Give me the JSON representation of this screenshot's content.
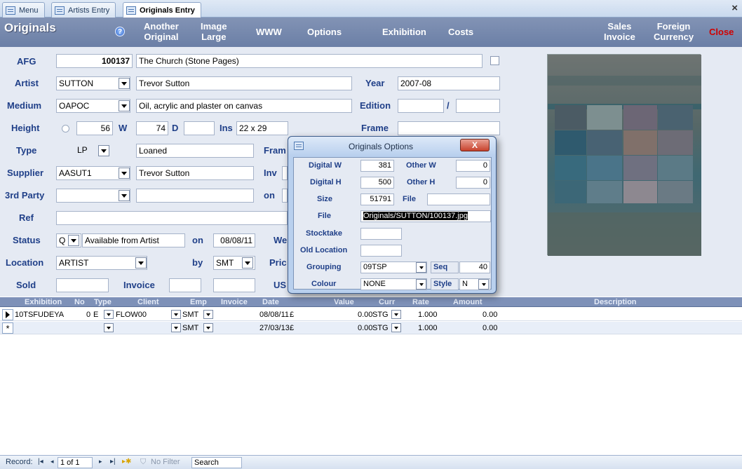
{
  "tabs": [
    {
      "label": "Menu"
    },
    {
      "label": "Artists Entry"
    },
    {
      "label": "Originals Entry"
    }
  ],
  "window_close": "×",
  "form_title": "Originals",
  "help_icon": "?",
  "header_buttons": {
    "another_original": "Another\nOriginal",
    "image_large": "Image\nLarge",
    "www": "WWW",
    "options": "Options",
    "exhibition": "Exhibition",
    "costs": "Costs",
    "sales_invoice": "Sales\nInvoice",
    "foreign_currency": "Foreign\nCurrency",
    "close": "Close"
  },
  "fields": {
    "afg_label": "AFG",
    "afg": "100137",
    "afg_title": "The Church (Stone Pages)",
    "artist_label": "Artist",
    "artist_code": "SUTTON",
    "artist_name": "Trevor Sutton",
    "year_label": "Year",
    "year": "2007-08",
    "medium_label": "Medium",
    "medium_code": "OAPOC",
    "medium_desc": "Oil, acrylic and plaster on canvas",
    "edition_label": "Edition",
    "edition_a": "",
    "edition_sep": "/",
    "edition_b": "",
    "height_label": "Height",
    "height": "56",
    "w_label": "W",
    "width": "74",
    "d_label": "D",
    "depth": "",
    "ins_label": "Ins",
    "ins": "22 x 29",
    "frame_label": "Frame",
    "frame": "",
    "type_label": "Type",
    "type_code": "LP",
    "type_desc": "Loaned",
    "frame2_label": "Fram",
    "supplier_label": "Supplier",
    "supplier_code": "AASUT1",
    "supplier_name": "Trevor Sutton",
    "inv_label": "Inv",
    "third_party_label": "3rd Party",
    "third_party_code": "",
    "third_party_name": "",
    "on_label": "on",
    "ref_label": "Ref",
    "ref": "",
    "status_label": "Status",
    "status_code": "Q",
    "status_desc": "Available from Artist",
    "status_on_label": "on",
    "status_date": "08/08/11",
    "we_label": "We",
    "location_label": "Location",
    "location": "ARTIST",
    "by_label": "by",
    "by": "SMT",
    "price_label": "Pric",
    "sold_label": "Sold",
    "sold": "",
    "invoice_label": "Invoice",
    "invoice_a": "",
    "invoice_b": "",
    "us_label": "US"
  },
  "datasheet": {
    "columns": [
      "Exhibition",
      "No",
      "Type",
      "Client",
      "Emp",
      "Invoice",
      "Date",
      "Value",
      "Curr",
      "Rate",
      "Amount",
      "Description"
    ],
    "rows": [
      {
        "exhibition": "10TSFUDEYA",
        "no": "0",
        "type": "E",
        "client": "FLOW00",
        "emp": "SMT",
        "invoice": "",
        "date": "08/08/11",
        "value": "£",
        "value_amt": "0.00",
        "curr": "STG",
        "rate": "1.000",
        "amount": "0.00",
        "description": ""
      },
      {
        "exhibition": "",
        "no": "",
        "type": "",
        "client": "",
        "emp": "SMT",
        "invoice": "",
        "date": "27/03/13",
        "value": "£",
        "value_amt": "0.00",
        "curr": "STG",
        "rate": "1.000",
        "amount": "0.00",
        "description": ""
      }
    ],
    "new_row_marker": "*"
  },
  "navbar": {
    "record_label": "Record:",
    "position": "1 of 1",
    "no_filter": "No Filter",
    "search": "Search"
  },
  "dialog": {
    "title": "Originals Options",
    "close": "X",
    "digital_w_label": "Digital W",
    "digital_w": "381",
    "other_w_label": "Other W",
    "other_w": "0",
    "digital_h_label": "Digital H",
    "digital_h": "500",
    "other_h_label": "Other H",
    "other_h": "0",
    "size_label": "Size",
    "size": "51791",
    "file_label_1": "File",
    "file_1": "",
    "file_label_2": "File",
    "file_2": "Originals/SUTTON/100137.jpg",
    "stocktake_label": "Stocktake",
    "stocktake": "",
    "old_location_label": "Old Location",
    "old_location": "",
    "grouping_label": "Grouping",
    "grouping": "09TSP",
    "seq_label": "Seq",
    "seq": "40",
    "colour_label": "Colour",
    "colour": "NONE",
    "style_label": "Style",
    "style": "N"
  }
}
